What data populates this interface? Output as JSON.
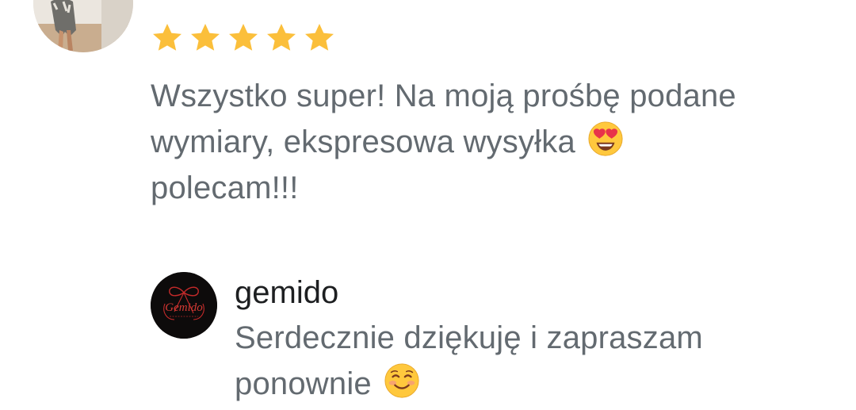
{
  "review": {
    "rating": 5,
    "rating_max": 5,
    "star_color": "#FBBF3B",
    "text_before_emoji": "Wszystko super! Na moją prośbę podane wymiary, ekspresowa wysyłka",
    "emoji_1": "smiling-face-with-heart-eyes",
    "text_after_emoji": "polecam!!!"
  },
  "reply": {
    "seller_name": "gemido",
    "logo_text": "Gemido",
    "text": "Serdecznie dziękuję i zapraszam ponownie",
    "emoji": "smiling-face-blushing"
  }
}
